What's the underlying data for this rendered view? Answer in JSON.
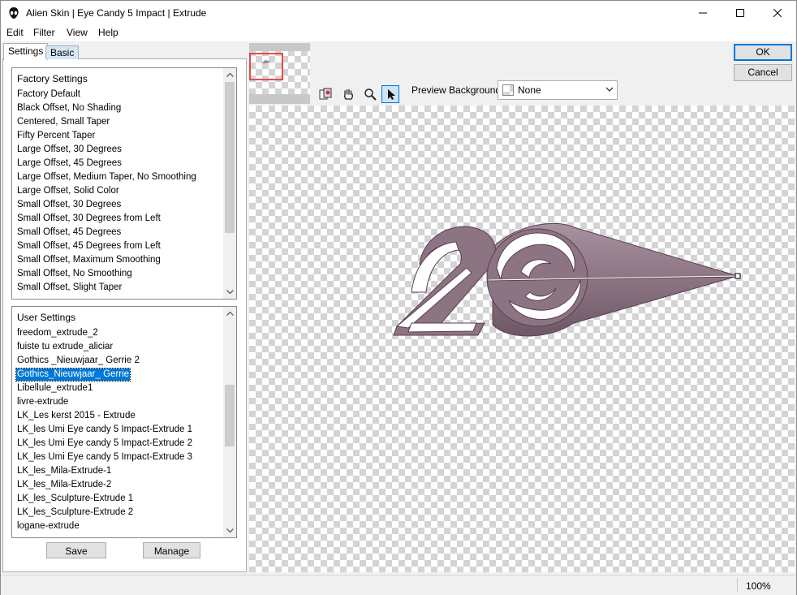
{
  "window": {
    "title": "Alien Skin | Eye Candy 5 Impact | Extrude"
  },
  "icons": {
    "app": "alien-head-icon",
    "minimize": "minimize-icon",
    "maximize": "maximize-icon",
    "close": "close-icon"
  },
  "menu": {
    "edit": "Edit",
    "filter": "Filter",
    "view": "View",
    "help": "Help"
  },
  "tabs": {
    "settings": "Settings",
    "basic": "Basic"
  },
  "factory": {
    "header": "Factory Settings",
    "items": [
      "Factory Default",
      "Black Offset, No Shading",
      "Centered, Small Taper",
      "Fifty Percent Taper",
      "Large Offset, 30 Degrees",
      "Large Offset, 45 Degrees",
      "Large Offset, Medium Taper, No Smoothing",
      "Large Offset, Solid Color",
      "Small Offset, 30 Degrees",
      "Small Offset, 30 Degrees from Left",
      "Small Offset, 45 Degrees",
      "Small Offset, 45 Degrees from Left",
      "Small Offset, Maximum Smoothing",
      "Small Offset, No Smoothing",
      "Small Offset, Slight Taper"
    ]
  },
  "user": {
    "header": "User Settings",
    "selected": "Gothics_Nieuwjaar_ Gerrie",
    "items": [
      "freedom_extrude_2",
      "fuiste tu extrude_aliciar",
      "Gothics _Nieuwjaar_ Gerrie 2",
      "Gothics_Nieuwjaar_ Gerrie",
      "Libellule_extrude1",
      "livre-extrude",
      "LK_Les kerst 2015 - Extrude",
      "LK_les Umi Eye candy 5 Impact-Extrude 1",
      "LK_les Umi Eye candy 5 Impact-Extrude 2",
      "LK_les Umi Eye candy 5 Impact-Extrude 3",
      "LK_les_Mila-Extrude-1",
      "LK_les_Mila-Extrude-2",
      "LK_les_Sculpture-Extrude 1",
      "LK_les_Sculpture-Extrude 2",
      "logane-extrude"
    ]
  },
  "buttons": {
    "save": "Save",
    "manage": "Manage",
    "ok": "OK",
    "cancel": "Cancel"
  },
  "preview_background": {
    "label": "Preview Background:",
    "value": "None"
  },
  "tools": [
    "preview-compare-icon",
    "hand-icon",
    "zoom-icon",
    "pointer-icon"
  ],
  "status": {
    "zoom": "100%"
  },
  "colors": {
    "accent": "#0078d7",
    "extrude": "#8c7482",
    "nav_frame": "#e8484c"
  }
}
